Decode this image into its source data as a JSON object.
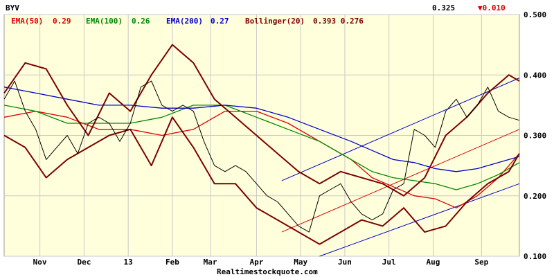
{
  "chart_data": {
    "type": "line",
    "symbol": "BYV",
    "last_price": "0.325",
    "change": "▼0.010",
    "watermark": "Realtimestockquote.com",
    "legend": [
      {
        "label": "EMA(50)",
        "value": "0.29",
        "color": "#dd0000"
      },
      {
        "label": "EMA(100)",
        "value": "0.26",
        "color": "#008800"
      },
      {
        "label": "EMA(200)",
        "value": "0.27",
        "color": "#0000cc"
      },
      {
        "label": "Bollinger(20)",
        "value": "0.393 0.276",
        "color": "#7a0000"
      }
    ],
    "x_tick_labels": [
      "Nov",
      "Dec",
      "13",
      "Feb",
      "Mar",
      "Apr",
      "May",
      "Jun",
      "Jul",
      "Aug",
      "Sep"
    ],
    "y_tick_labels": [
      "0.500",
      "0.400",
      "0.300",
      "0.200",
      "0.100"
    ],
    "ylim": [
      0.1,
      0.5
    ],
    "grid": true,
    "trading_days": 245,
    "month_start_days": [
      17,
      38,
      59,
      80,
      98,
      120,
      141,
      162,
      183,
      204,
      227
    ],
    "series": [
      {
        "name": "EMA(50)",
        "color": "#dd0000",
        "x": [
          0,
          15,
          30,
          45,
          60,
          75,
          90,
          105,
          120,
          135,
          150,
          165,
          175,
          185,
          195,
          205,
          215,
          225,
          235,
          245
        ],
        "values": [
          0.33,
          0.34,
          0.33,
          0.31,
          0.31,
          0.3,
          0.31,
          0.34,
          0.34,
          0.32,
          0.29,
          0.26,
          0.23,
          0.215,
          0.2,
          0.195,
          0.18,
          0.2,
          0.23,
          0.27
        ]
      },
      {
        "name": "EMA(100)",
        "color": "#008800",
        "x": [
          0,
          15,
          30,
          45,
          60,
          75,
          90,
          105,
          120,
          135,
          150,
          165,
          175,
          185,
          195,
          205,
          215,
          225,
          235,
          245
        ],
        "values": [
          0.35,
          0.34,
          0.32,
          0.32,
          0.32,
          0.33,
          0.35,
          0.35,
          0.33,
          0.31,
          0.29,
          0.26,
          0.24,
          0.23,
          0.225,
          0.22,
          0.21,
          0.22,
          0.235,
          0.255
        ]
      },
      {
        "name": "EMA(200)",
        "color": "#0000cc",
        "x": [
          0,
          15,
          30,
          45,
          60,
          75,
          90,
          105,
          120,
          135,
          150,
          165,
          175,
          185,
          195,
          205,
          215,
          225,
          235,
          245
        ],
        "values": [
          0.38,
          0.37,
          0.36,
          0.35,
          0.35,
          0.345,
          0.345,
          0.35,
          0.345,
          0.33,
          0.31,
          0.29,
          0.275,
          0.26,
          0.255,
          0.245,
          0.24,
          0.245,
          0.255,
          0.265
        ]
      },
      {
        "name": "Bollinger upper",
        "color": "#7a0000",
        "x": [
          0,
          10,
          20,
          30,
          40,
          50,
          60,
          70,
          80,
          90,
          100,
          110,
          120,
          130,
          140,
          150,
          160,
          170,
          180,
          190,
          200,
          210,
          220,
          230,
          240,
          245
        ],
        "values": [
          0.37,
          0.42,
          0.41,
          0.35,
          0.3,
          0.37,
          0.34,
          0.4,
          0.45,
          0.42,
          0.36,
          0.33,
          0.3,
          0.27,
          0.24,
          0.22,
          0.24,
          0.23,
          0.22,
          0.2,
          0.23,
          0.3,
          0.33,
          0.37,
          0.4,
          0.39
        ]
      },
      {
        "name": "Bollinger lower",
        "color": "#7a0000",
        "x": [
          0,
          10,
          20,
          30,
          40,
          50,
          60,
          70,
          80,
          90,
          100,
          110,
          120,
          130,
          140,
          150,
          160,
          170,
          180,
          190,
          200,
          210,
          220,
          230,
          240,
          245
        ],
        "values": [
          0.3,
          0.28,
          0.23,
          0.26,
          0.28,
          0.3,
          0.31,
          0.25,
          0.33,
          0.28,
          0.22,
          0.22,
          0.18,
          0.16,
          0.14,
          0.12,
          0.14,
          0.16,
          0.15,
          0.18,
          0.14,
          0.15,
          0.19,
          0.22,
          0.24,
          0.27
        ]
      },
      {
        "name": "Price",
        "color": "#000000",
        "x": [
          0,
          5,
          10,
          15,
          20,
          25,
          30,
          35,
          40,
          45,
          50,
          55,
          60,
          65,
          70,
          75,
          80,
          85,
          90,
          95,
          100,
          105,
          110,
          115,
          120,
          125,
          130,
          135,
          140,
          145,
          150,
          155,
          160,
          165,
          170,
          175,
          180,
          185,
          190,
          195,
          200,
          205,
          210,
          215,
          220,
          225,
          230,
          235,
          240,
          245
        ],
        "values": [
          0.36,
          0.39,
          0.34,
          0.31,
          0.26,
          0.28,
          0.3,
          0.27,
          0.32,
          0.33,
          0.32,
          0.29,
          0.32,
          0.38,
          0.39,
          0.35,
          0.34,
          0.35,
          0.34,
          0.29,
          0.25,
          0.24,
          0.25,
          0.24,
          0.22,
          0.2,
          0.19,
          0.17,
          0.15,
          0.14,
          0.2,
          0.21,
          0.22,
          0.19,
          0.17,
          0.16,
          0.17,
          0.21,
          0.22,
          0.31,
          0.3,
          0.28,
          0.34,
          0.36,
          0.33,
          0.35,
          0.38,
          0.34,
          0.33,
          0.325
        ]
      }
    ],
    "trendlines": [
      {
        "color": "#0000cc",
        "x": [
          132,
          245
        ],
        "values": [
          0.225,
          0.395
        ]
      },
      {
        "color": "#dd0000",
        "x": [
          132,
          245
        ],
        "values": [
          0.14,
          0.31
        ]
      },
      {
        "color": "#0000cc",
        "x": [
          150,
          245
        ],
        "values": [
          0.1,
          0.22
        ]
      }
    ]
  }
}
